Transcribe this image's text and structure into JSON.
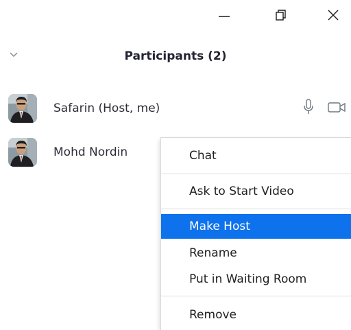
{
  "panel": {
    "title": "Participants (2)"
  },
  "participants": [
    {
      "name": "Safarin (Host, me)",
      "avatar": "user-photo",
      "mic": "microphone-icon",
      "video": "video-camera-icon"
    },
    {
      "name": "Mohd Nordin",
      "avatar": "user-photo"
    }
  ],
  "context_menu": {
    "items": [
      {
        "label": "Chat"
      },
      {
        "label": "Ask to Start Video"
      },
      {
        "label": "Make Host",
        "highlighted": true
      },
      {
        "label": "Rename"
      },
      {
        "label": "Put in Waiting Room"
      },
      {
        "label": "Remove"
      }
    ]
  },
  "colors": {
    "highlight": "#0e72ed",
    "text": "#232333",
    "icon": "#6e7680"
  },
  "icons": {
    "minimize": "minimize-icon",
    "restore": "restore-icon",
    "close": "close-icon",
    "collapse": "chevron-down-icon"
  }
}
